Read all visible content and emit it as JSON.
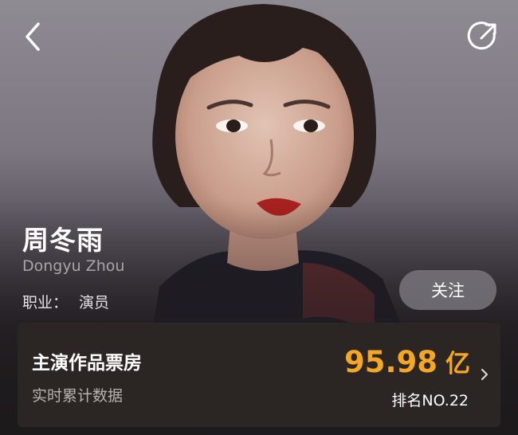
{
  "header": {
    "back_icon": "chevron-left-icon",
    "share_icon": "share-icon"
  },
  "profile": {
    "name": "周冬雨",
    "name_en": "Dongyu Zhou",
    "job_label": "职业：",
    "job_value": "演员",
    "follow_label": "关注"
  },
  "box_office_card": {
    "title": "主演作品票房",
    "subtitle": "实时累计数据",
    "value": "95.98",
    "unit": "亿",
    "rank": "排名NO.22",
    "value_color": "#f5a623",
    "arrow_icon": "chevron-right-icon"
  }
}
